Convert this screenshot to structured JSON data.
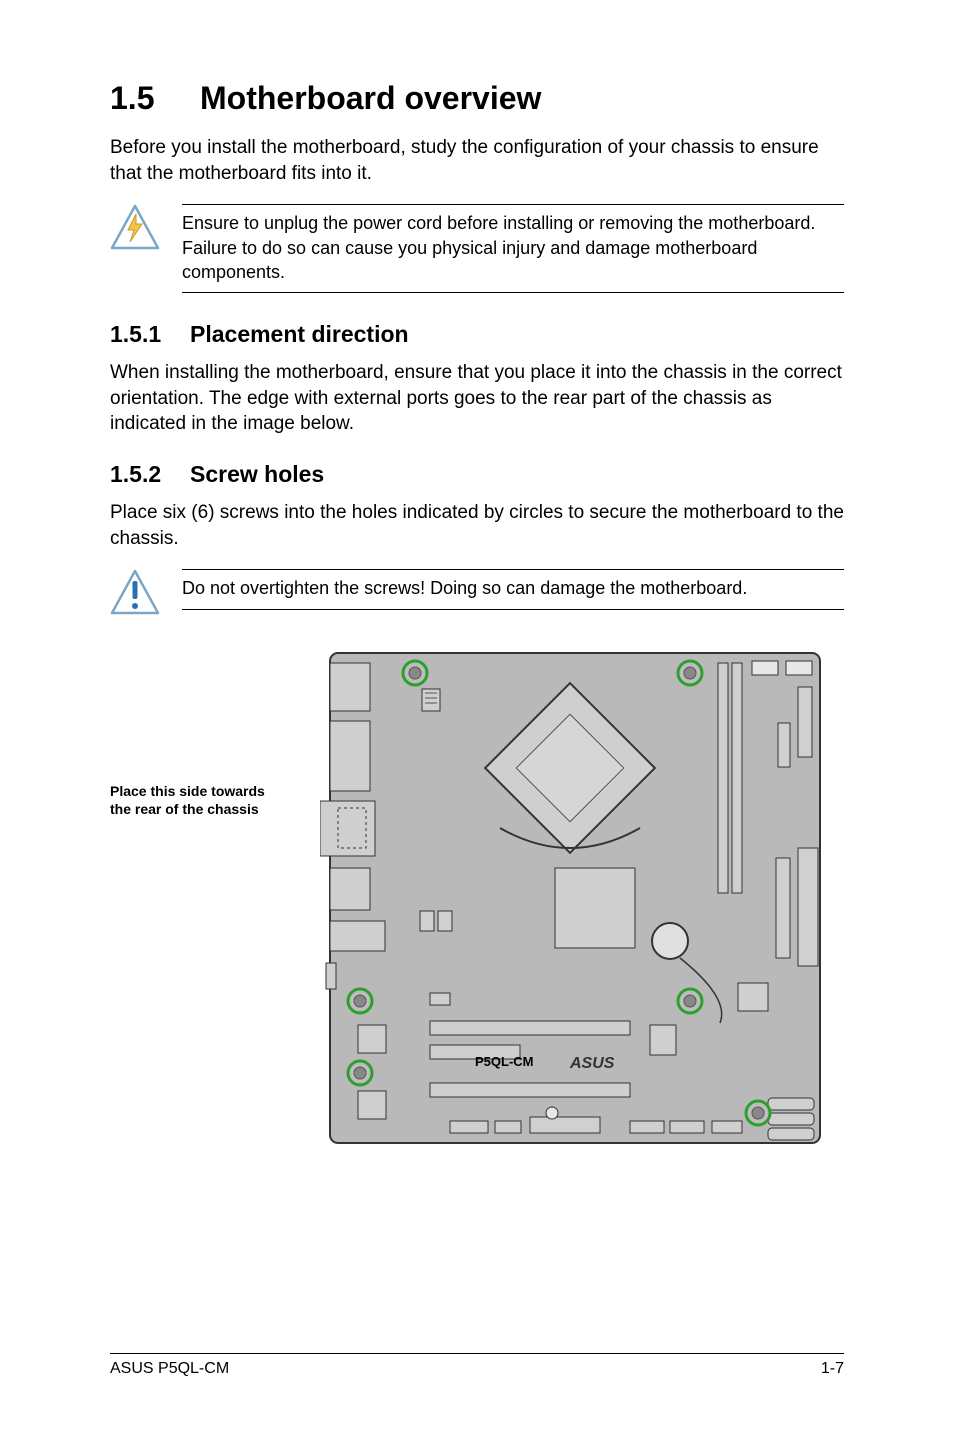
{
  "heading": {
    "number": "1.5",
    "title": "Motherboard overview"
  },
  "intro": "Before you install the motherboard, study the configuration of your chassis to ensure that the motherboard fits into it.",
  "danger_note": "Ensure to unplug the power cord before installing or removing the motherboard. Failure to do so can cause you physical injury and damage motherboard components.",
  "sec151": {
    "number": "1.5.1",
    "title": "Placement direction"
  },
  "sec151_body": "When installing the motherboard, ensure that you place it into the chassis in the correct orientation. The edge with external ports goes to the rear part of the chassis as indicated in the image below.",
  "sec152": {
    "number": "1.5.2",
    "title": "Screw holes"
  },
  "sec152_body": "Place six (6) screws into the holes indicated by circles to secure the motherboard to the chassis.",
  "caution_note": "Do not overtighten the screws! Doing so can damage the motherboard.",
  "diagram": {
    "side_label_line1": "Place this side towards",
    "side_label_line2": "the rear of the chassis",
    "board_model": "P5QL-CM",
    "brand": "ASUS",
    "screw_hole_count": 6
  },
  "footer": {
    "left": "ASUS P5QL-CM",
    "right": "1-7"
  }
}
